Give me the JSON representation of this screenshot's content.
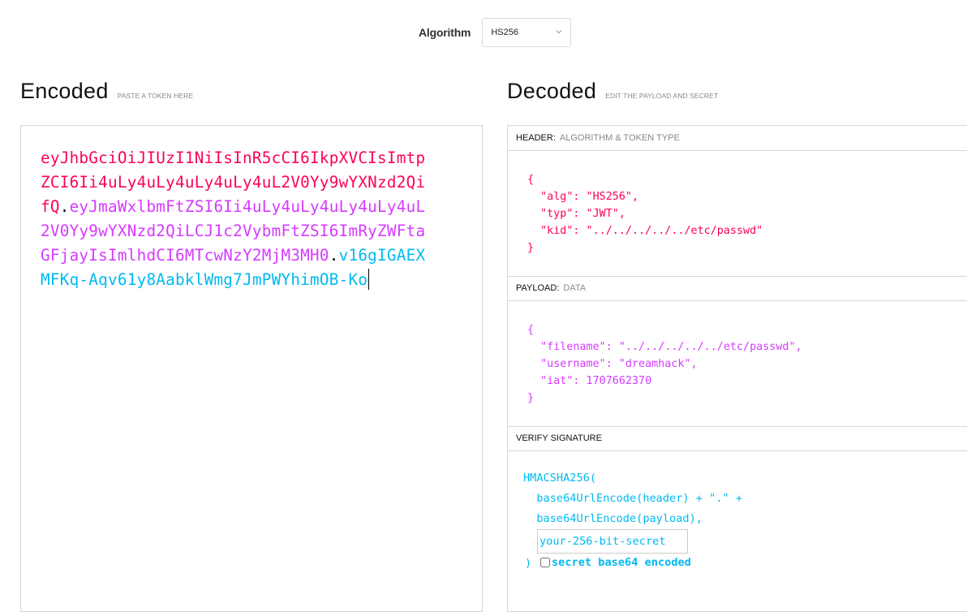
{
  "algorithm": {
    "label": "Algorithm",
    "selected": "HS256"
  },
  "encoded": {
    "title": "Encoded",
    "subtitle": "PASTE A TOKEN HERE",
    "token": {
      "header": "eyJhbGciOiJIUzI1NiIsInR5cCI6IkpXVCIsImtpZCI6Ii4uLy4uLy4uLy4uLy4uL2V0Yy9wYXNzd2QifQ",
      "payload": "eyJmaWxlbmFtZSI6Ii4uLy4uLy4uLy4uLy4uL2V0Yy9wYXNzd2QiLCJ1c2VybmFtZSI6ImRyZWFtaGFjayIsImlhdCI6MTcwNzY2MjM3MH0",
      "signature": "v16gIGAEXMFKq-Aqv61y8AabklWmg7JmPWYhimOB-Ko",
      "dot": "."
    }
  },
  "decoded": {
    "title": "Decoded",
    "subtitle": "EDIT THE PAYLOAD AND SECRET",
    "header_panel": {
      "label": "HEADER:",
      "sublabel": "ALGORITHM & TOKEN TYPE",
      "json": "{\n  \"alg\": \"HS256\",\n  \"typ\": \"JWT\",\n  \"kid\": \"../../../../../etc/passwd\"\n}"
    },
    "payload_panel": {
      "label": "PAYLOAD:",
      "sublabel": "DATA",
      "json": "{\n  \"filename\": \"../../../../../etc/passwd\",\n  \"username\": \"dreamhack\",\n  \"iat\": 1707662370\n}"
    },
    "verify_panel": {
      "label": "VERIFY SIGNATURE",
      "fn_open": "HMACSHA256(",
      "line1": "  base64UrlEncode(header) + \".\" +",
      "line2": "  base64UrlEncode(payload),",
      "secret_placeholder": "your-256-bit-secret",
      "close": ")",
      "base64_label": "secret base64 encoded",
      "base64_checked": false
    }
  },
  "colors": {
    "header": "#fb015b",
    "payload": "#d63aff",
    "signature": "#00b9f1"
  }
}
